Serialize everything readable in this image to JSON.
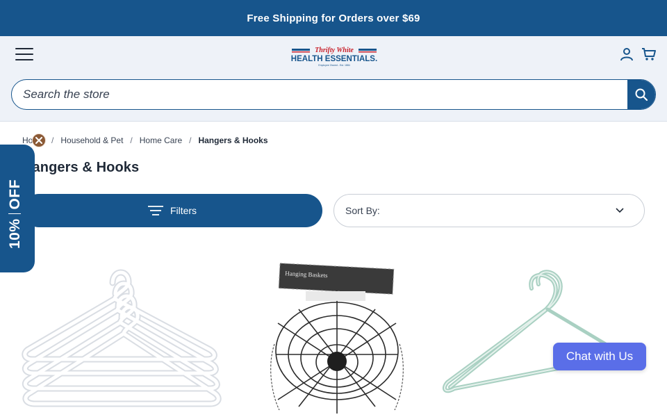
{
  "promo": {
    "text": "Free Shipping for Orders over $69"
  },
  "header": {
    "logo_top": "Thrifty White",
    "logo_main": "HEALTH ESSENTIALS.",
    "logo_tagline": "Employee Owned - Est. 1884"
  },
  "search": {
    "placeholder": "Search the store"
  },
  "breadcrumb": {
    "items": [
      "Home",
      "Household & Pet",
      "Home Care",
      "Hangers & Hooks"
    ]
  },
  "page": {
    "title": "Hangers & Hooks"
  },
  "toolbar": {
    "filters_label": "Filters",
    "sort_label": "Sort By:"
  },
  "promo_tab": {
    "percent": "10%",
    "off": "OFF"
  },
  "product_packaging": {
    "label": "Hanging Baskets"
  },
  "chat": {
    "label": "Chat with Us"
  },
  "colors": {
    "brand": "#17558c",
    "chat": "#5a6ee8",
    "close_badge": "#8b5a36"
  },
  "icons": [
    "menu-icon",
    "account-icon",
    "cart-icon",
    "search-icon",
    "filter-icon",
    "chevron-down-icon",
    "close-icon"
  ]
}
